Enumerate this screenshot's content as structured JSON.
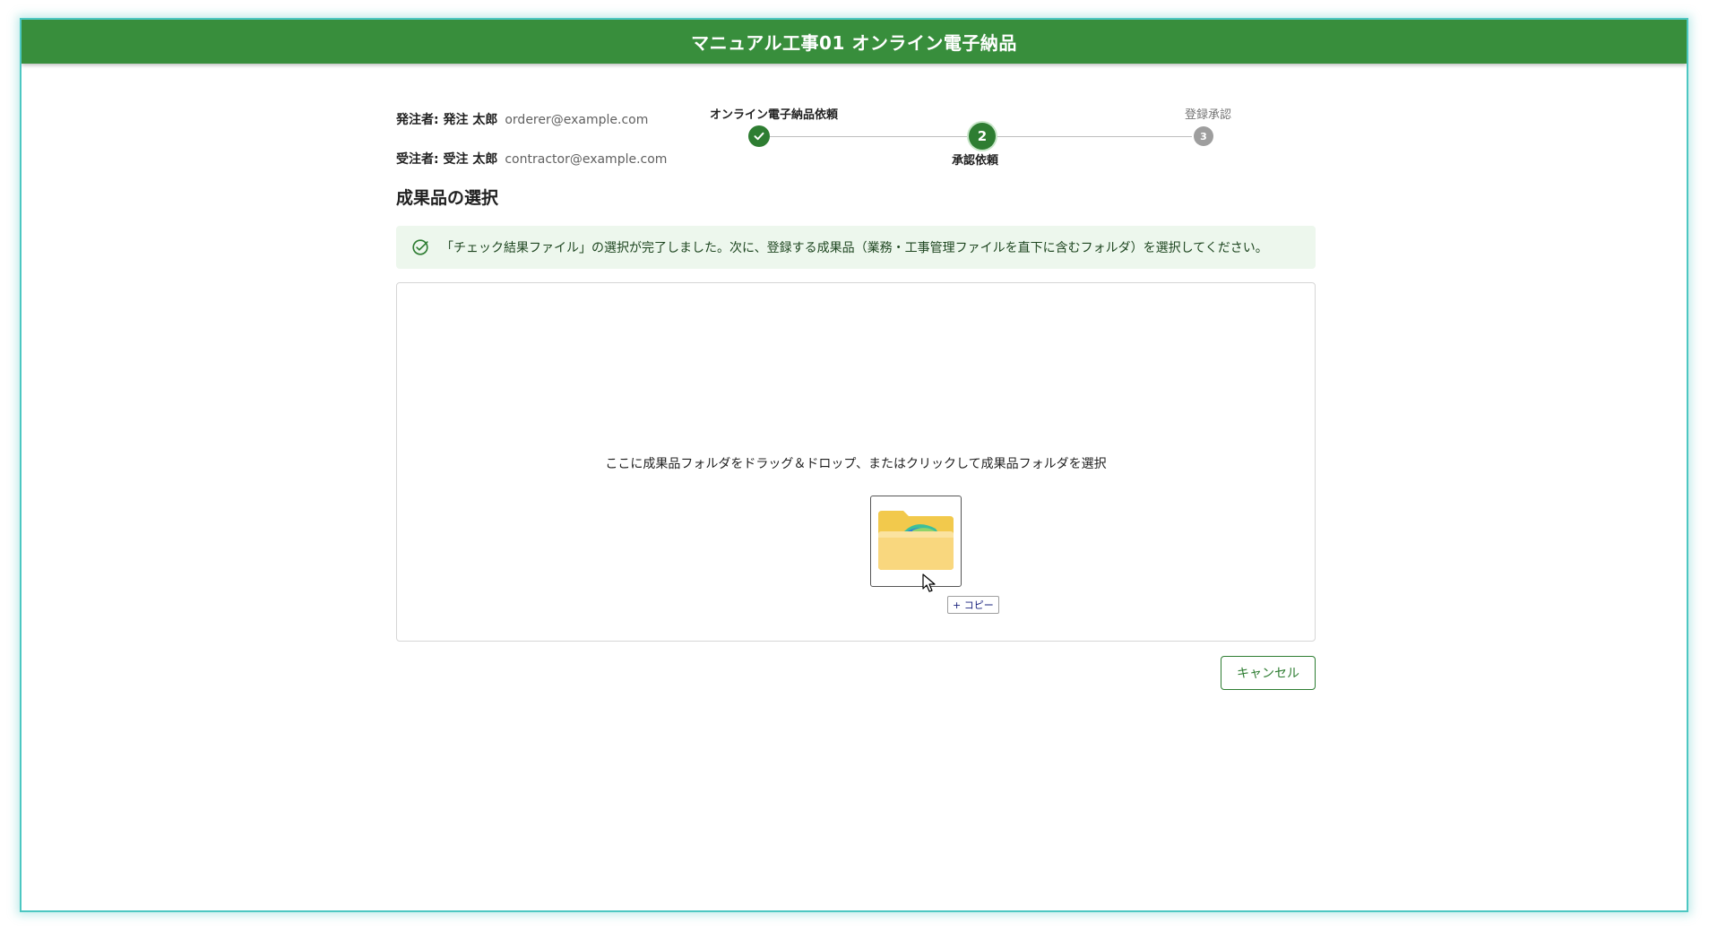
{
  "window": {
    "title": "マニュアル工事01 オンライン電子納品"
  },
  "parties": {
    "orderer": {
      "label": "発注者: 発注 太郎",
      "email": "orderer@example.com"
    },
    "contractor": {
      "label": "受注者: 受注 太郎",
      "email": "contractor@example.com"
    }
  },
  "stepper": {
    "steps": [
      {
        "label": "オンライン電子納品依頼",
        "state": "completed",
        "icon": "check-icon"
      },
      {
        "label": "承認依頼",
        "state": "active",
        "number": "2"
      },
      {
        "label": "登録承認",
        "state": "pending",
        "number": "3"
      }
    ]
  },
  "section": {
    "title": "成果品の選択"
  },
  "alert": {
    "icon": "check-circle-icon",
    "text": "「チェック結果ファイル」の選択が完了しました。次に、登録する成果品（業務・工事管理ファイルを直下に含むフォルダ）を選択してください。"
  },
  "dropzone": {
    "text": "ここに成果品フォルダをドラッグ＆ドロップ、またはクリックして成果品フォルダを選択",
    "drag_badge": "+ コピー"
  },
  "actions": {
    "cancel_label": "キャンセル"
  },
  "colors": {
    "brand": "#388e3c",
    "accent": "#2e7d32",
    "alert_bg": "#edf7ed",
    "pending": "#9e9e9e"
  }
}
